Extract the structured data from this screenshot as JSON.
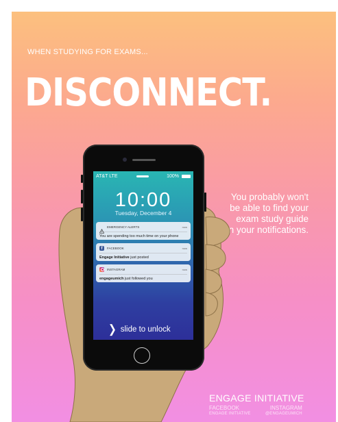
{
  "poster": {
    "tagline": "WHEN STUDYING FOR EXAMS...",
    "headline": "DISCONNECT.",
    "side_text": "You probably won't be able to find your exam study guide in your notifications.",
    "footer": {
      "brand": "ENGAGE INITIATIVE",
      "facebook_label": "FACEBOOK",
      "facebook_handle": "ENGAGE INITIATIVE",
      "instagram_label": "INSTAGRAM",
      "instagram_handle": "@ENGAGEUMICH"
    }
  },
  "phone": {
    "status": {
      "carrier": "AT&T  LTE",
      "battery": "100%"
    },
    "time": "10:00",
    "date": "Tuesday, December 4",
    "notifications": [
      {
        "app": "EMERGENCY ALERTS",
        "when": "now",
        "text": "You are spending too much time on your phone",
        "icon": "warning-icon"
      },
      {
        "app": "FACEBOOK",
        "when": "now",
        "bold": "Engage Initiative",
        "text": " just posted",
        "icon": "facebook-icon"
      },
      {
        "app": "INSTAGRAM",
        "when": "now",
        "bold": "engageumich",
        "text": " just followed you",
        "icon": "instagram-icon"
      }
    ],
    "unlock_text": "slide to unlock"
  },
  "colors": {
    "gradient_top": "#fcc07e",
    "gradient_bottom": "#f28fe3",
    "screen_top": "#29b6b3",
    "screen_bottom": "#2d2f99",
    "skin": "#c9a97a"
  }
}
